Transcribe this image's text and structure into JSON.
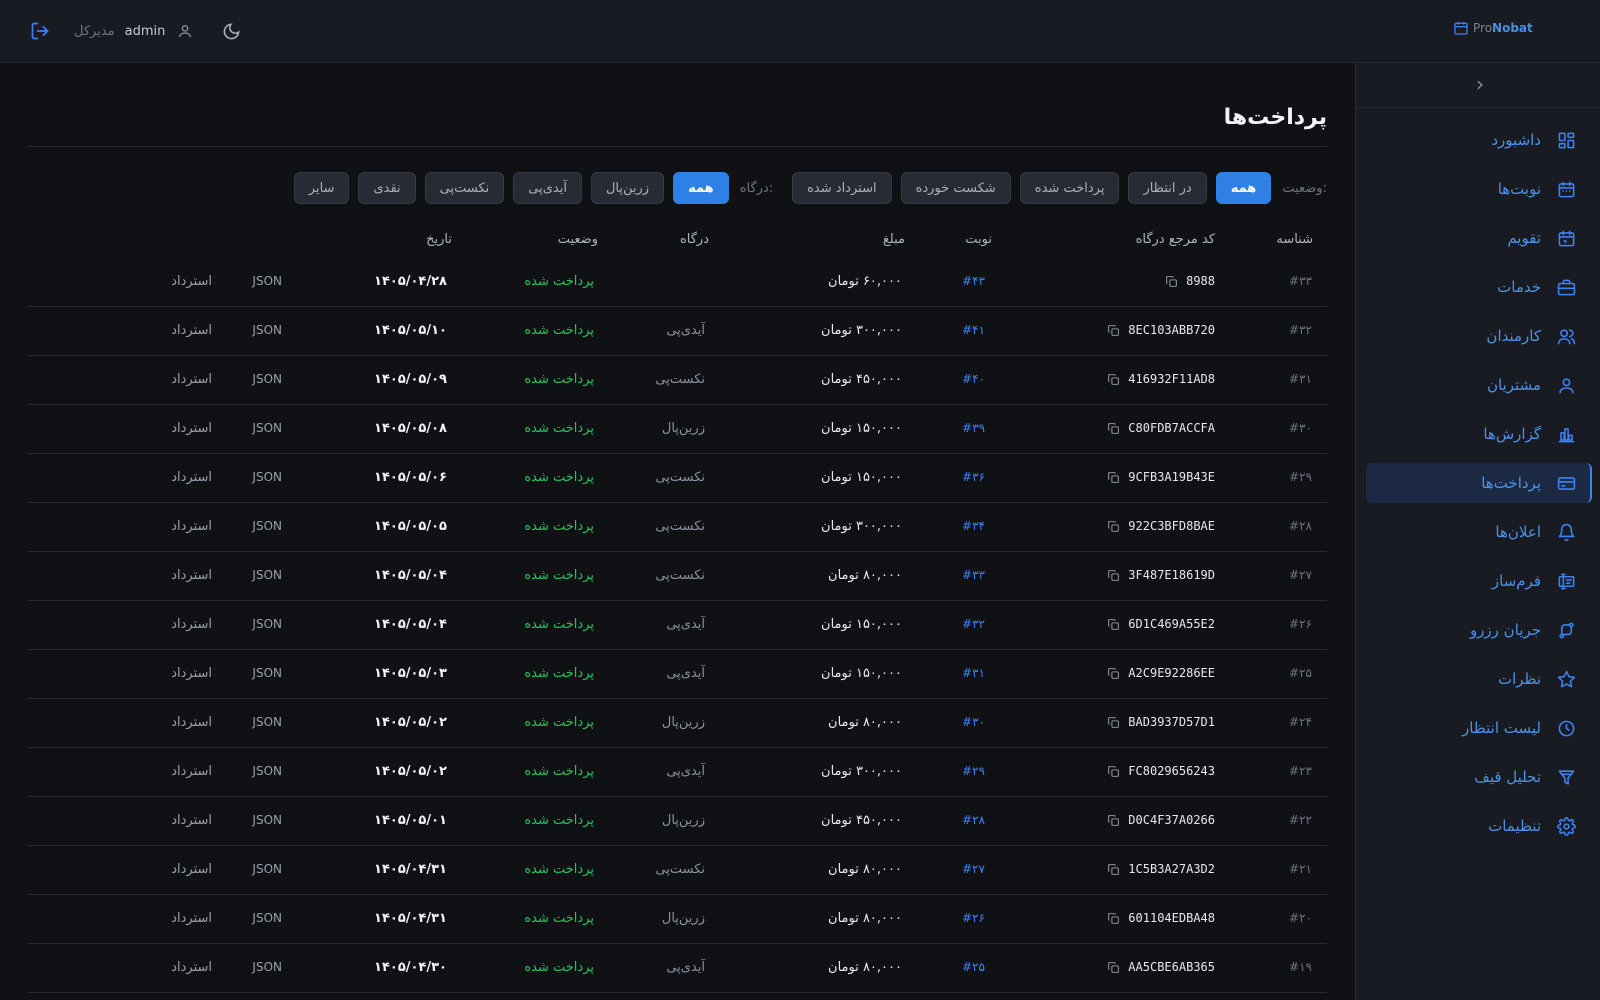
{
  "brand": {
    "pre": "Pro",
    "post": "Nobat"
  },
  "header": {
    "role": "مدیرکل",
    "username": "admin"
  },
  "sidebar": {
    "items": [
      {
        "label": "داشبورد",
        "icon": "dashboard-icon"
      },
      {
        "label": "نوبت‌ها",
        "icon": "calendar-icon"
      },
      {
        "label": "تقویم",
        "icon": "calendar-day-icon"
      },
      {
        "label": "خدمات",
        "icon": "briefcase-icon"
      },
      {
        "label": "کارمندان",
        "icon": "users-icon"
      },
      {
        "label": "مشتریان",
        "icon": "user-icon"
      },
      {
        "label": "گزارش‌ها",
        "icon": "bar-chart-icon"
      },
      {
        "label": "پرداخت‌ها",
        "icon": "credit-card-icon",
        "active": true
      },
      {
        "label": "اعلان‌ها",
        "icon": "bell-icon"
      },
      {
        "label": "فرم‌ساز",
        "icon": "form-builder-icon"
      },
      {
        "label": "جریان رزرو",
        "icon": "flow-icon"
      },
      {
        "label": "نظرات",
        "icon": "star-icon"
      },
      {
        "label": "لیست انتظار",
        "icon": "clock-icon"
      },
      {
        "label": "تحلیل قیف",
        "icon": "funnel-icon"
      },
      {
        "label": "تنظیمات",
        "icon": "gear-icon"
      }
    ]
  },
  "page": {
    "title": "پرداخت‌ها"
  },
  "filters": {
    "status_label": "وضعیت:",
    "status": [
      "همه",
      "در انتظار",
      "پرداخت شده",
      "شکست خورده",
      "استرداد شده"
    ],
    "status_selected": "همه",
    "gateway_label": "درگاه:",
    "gateway": [
      "همه",
      "زرین‌پال",
      "آیدی‌پی",
      "نکست‌پی",
      "نقدی",
      "سایر"
    ],
    "gateway_selected": "همه"
  },
  "table": {
    "columns": {
      "id": "شناسه",
      "code": "کد مرجع درگاه",
      "appointment": "نوبت",
      "amount": "مبلغ",
      "gateway": "درگاه",
      "status": "وضعیت",
      "date": "تاریخ"
    },
    "json_label": "JSON",
    "refund_label": "استرداد",
    "rows": [
      {
        "id": "#۳۳",
        "code": "8988",
        "appointment": "#۴۳",
        "amount": "۶۰,۰۰۰  تومان",
        "gateway": "",
        "status": "پرداخت شده",
        "date": "۱۴۰۵/۰۴/۲۸"
      },
      {
        "id": "#۳۲",
        "code": "8EC103ABB720",
        "appointment": "#۴۱",
        "amount": "۳۰۰,۰۰۰  تومان",
        "gateway": "آیدی‌پی",
        "status": "پرداخت شده",
        "date": "۱۴۰۵/۰۵/۱۰"
      },
      {
        "id": "#۳۱",
        "code": "416932F11AD8",
        "appointment": "#۴۰",
        "amount": "۴۵۰,۰۰۰  تومان",
        "gateway": "نکست‌پی",
        "status": "پرداخت شده",
        "date": "۱۴۰۵/۰۵/۰۹"
      },
      {
        "id": "#۳۰",
        "code": "C80FDB7ACCFA",
        "appointment": "#۳۹",
        "amount": "۱۵۰,۰۰۰  تومان",
        "gateway": "زرین‌پال",
        "status": "پرداخت شده",
        "date": "۱۴۰۵/۰۵/۰۸"
      },
      {
        "id": "#۲۹",
        "code": "9CFB3A19B43E",
        "appointment": "#۳۶",
        "amount": "۱۵۰,۰۰۰  تومان",
        "gateway": "نکست‌پی",
        "status": "پرداخت شده",
        "date": "۱۴۰۵/۰۵/۰۶"
      },
      {
        "id": "#۲۸",
        "code": "922C3BFD8BAE",
        "appointment": "#۳۴",
        "amount": "۳۰۰,۰۰۰  تومان",
        "gateway": "نکست‌پی",
        "status": "پرداخت شده",
        "date": "۱۴۰۵/۰۵/۰۵"
      },
      {
        "id": "#۲۷",
        "code": "3F487E18619D",
        "appointment": "#۳۳",
        "amount": "۸۰,۰۰۰  تومان",
        "gateway": "نکست‌پی",
        "status": "پرداخت شده",
        "date": "۱۴۰۵/۰۵/۰۴"
      },
      {
        "id": "#۲۶",
        "code": "6D1C469A55E2",
        "appointment": "#۳۲",
        "amount": "۱۵۰,۰۰۰  تومان",
        "gateway": "آیدی‌پی",
        "status": "پرداخت شده",
        "date": "۱۴۰۵/۰۵/۰۴"
      },
      {
        "id": "#۲۵",
        "code": "A2C9E92286EE",
        "appointment": "#۳۱",
        "amount": "۱۵۰,۰۰۰  تومان",
        "gateway": "آیدی‌پی",
        "status": "پرداخت شده",
        "date": "۱۴۰۵/۰۵/۰۳"
      },
      {
        "id": "#۲۴",
        "code": "BAD3937D57D1",
        "appointment": "#۳۰",
        "amount": "۸۰,۰۰۰  تومان",
        "gateway": "زرین‌پال",
        "status": "پرداخت شده",
        "date": "۱۴۰۵/۰۵/۰۲"
      },
      {
        "id": "#۲۳",
        "code": "FC8029656243",
        "appointment": "#۲۹",
        "amount": "۳۰۰,۰۰۰  تومان",
        "gateway": "آیدی‌پی",
        "status": "پرداخت شده",
        "date": "۱۴۰۵/۰۵/۰۲"
      },
      {
        "id": "#۲۲",
        "code": "D0C4F37A0266",
        "appointment": "#۲۸",
        "amount": "۴۵۰,۰۰۰  تومان",
        "gateway": "زرین‌پال",
        "status": "پرداخت شده",
        "date": "۱۴۰۵/۰۵/۰۱"
      },
      {
        "id": "#۲۱",
        "code": "1C5B3A27A3D2",
        "appointment": "#۲۷",
        "amount": "۸۰,۰۰۰  تومان",
        "gateway": "نکست‌پی",
        "status": "پرداخت شده",
        "date": "۱۴۰۵/۰۴/۳۱"
      },
      {
        "id": "#۲۰",
        "code": "601104EDBA48",
        "appointment": "#۲۶",
        "amount": "۸۰,۰۰۰  تومان",
        "gateway": "زرین‌پال",
        "status": "پرداخت شده",
        "date": "۱۴۰۵/۰۴/۳۱"
      },
      {
        "id": "#۱۹",
        "code": "AA5CBE6AB365",
        "appointment": "#۲۵",
        "amount": "۸۰,۰۰۰  تومان",
        "gateway": "آیدی‌پی",
        "status": "پرداخت شده",
        "date": "۱۴۰۵/۰۴/۳۰"
      }
    ]
  },
  "colors": {
    "accent": "#3b82f6",
    "success": "#22c55e",
    "background": "#0f1115",
    "panel": "#181b22"
  }
}
